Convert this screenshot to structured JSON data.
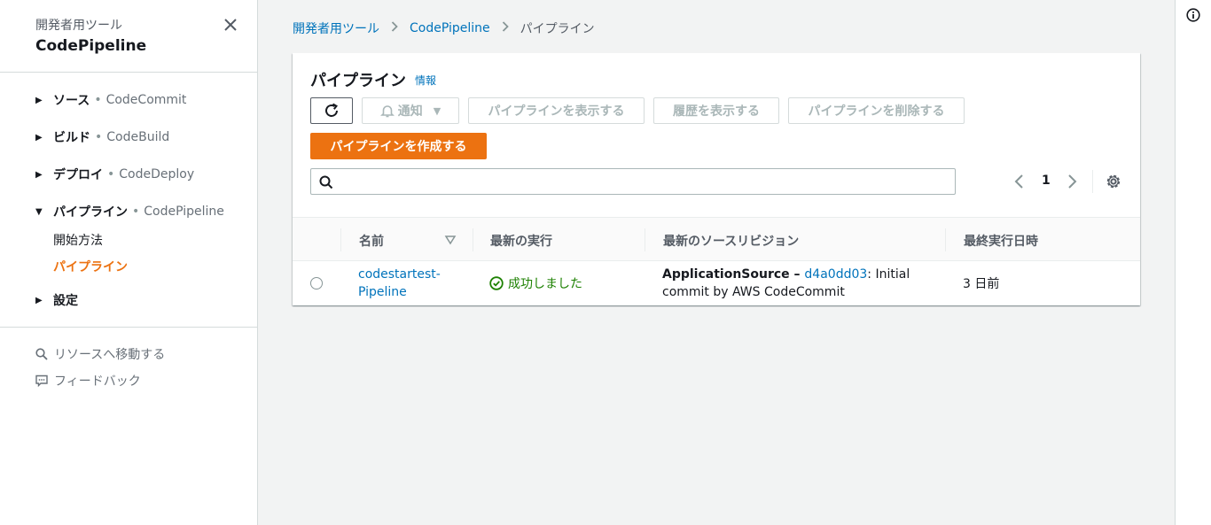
{
  "sidebar": {
    "subtitle": "開発者用ツール",
    "title": "CodePipeline",
    "nav": [
      {
        "label": "ソース",
        "sub": "CodeCommit",
        "expanded": false
      },
      {
        "label": "ビルド",
        "sub": "CodeBuild",
        "expanded": false
      },
      {
        "label": "デプロイ",
        "sub": "CodeDeploy",
        "expanded": false
      },
      {
        "label": "パイプライン",
        "sub": "CodePipeline",
        "expanded": true
      },
      {
        "label": "設定",
        "sub": "",
        "expanded": false
      }
    ],
    "pipeline_children": [
      "開始方法",
      "パイプライン"
    ],
    "separator": "•",
    "goto_resource": "リソースへ移動する",
    "feedback": "フィードバック"
  },
  "breadcrumb": {
    "items": [
      "開発者用ツール",
      "CodePipeline"
    ],
    "current": "パイプライン"
  },
  "panel": {
    "title": "パイプライン",
    "info": "情報",
    "buttons": {
      "notify": "通知",
      "view": "パイプラインを表示する",
      "history": "履歴を表示する",
      "delete": "パイプラインを削除する",
      "create": "パイプラインを作成する"
    },
    "search": {
      "value": "",
      "placeholder": ""
    },
    "pagination": {
      "page": "1"
    }
  },
  "table": {
    "columns": [
      "名前",
      "最新の実行",
      "最新のソースリビジョン",
      "最終実行日時"
    ],
    "rows": [
      {
        "name": "codestartest-Pipeline",
        "status": "成功しました",
        "source_name": "ApplicationSource",
        "source_dash": " – ",
        "revision": "d4a0dd03",
        "commit_message": ": Initial commit by AWS CodeCommit",
        "last_executed": "3 日前"
      }
    ]
  },
  "colors": {
    "accent": "#ec7211",
    "link": "#0073bb",
    "success": "#1d8102"
  }
}
